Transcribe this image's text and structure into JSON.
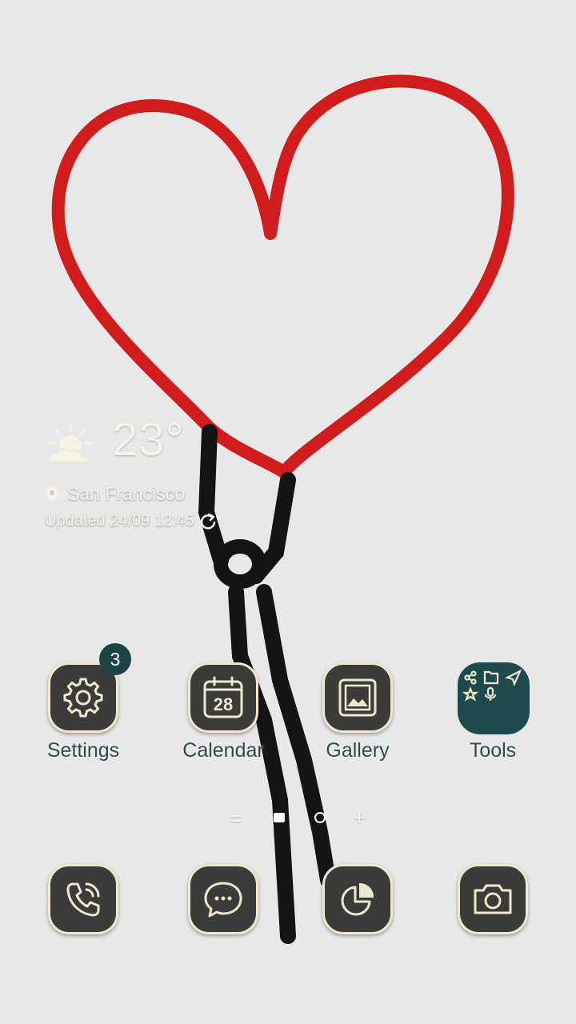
{
  "weather": {
    "temperature": "23°",
    "location": "San Francisco",
    "updated": "Updated 24/09 12:45"
  },
  "apps": {
    "settings": {
      "label": "Settings",
      "badge": "3"
    },
    "calendar": {
      "label": "Calendar",
      "date": "28"
    },
    "gallery": {
      "label": "Gallery"
    },
    "tools": {
      "label": "Tools"
    }
  },
  "dock": [
    "phone",
    "messages",
    "analytics",
    "camera"
  ],
  "pager": {
    "menu": "=",
    "add": "+"
  },
  "colors": {
    "heart": "#d01c1c",
    "icon_bg": "#3b3b39",
    "icon_border": "#efe8cd",
    "accent": "#1f4a4d",
    "label": "#2d4b51"
  }
}
